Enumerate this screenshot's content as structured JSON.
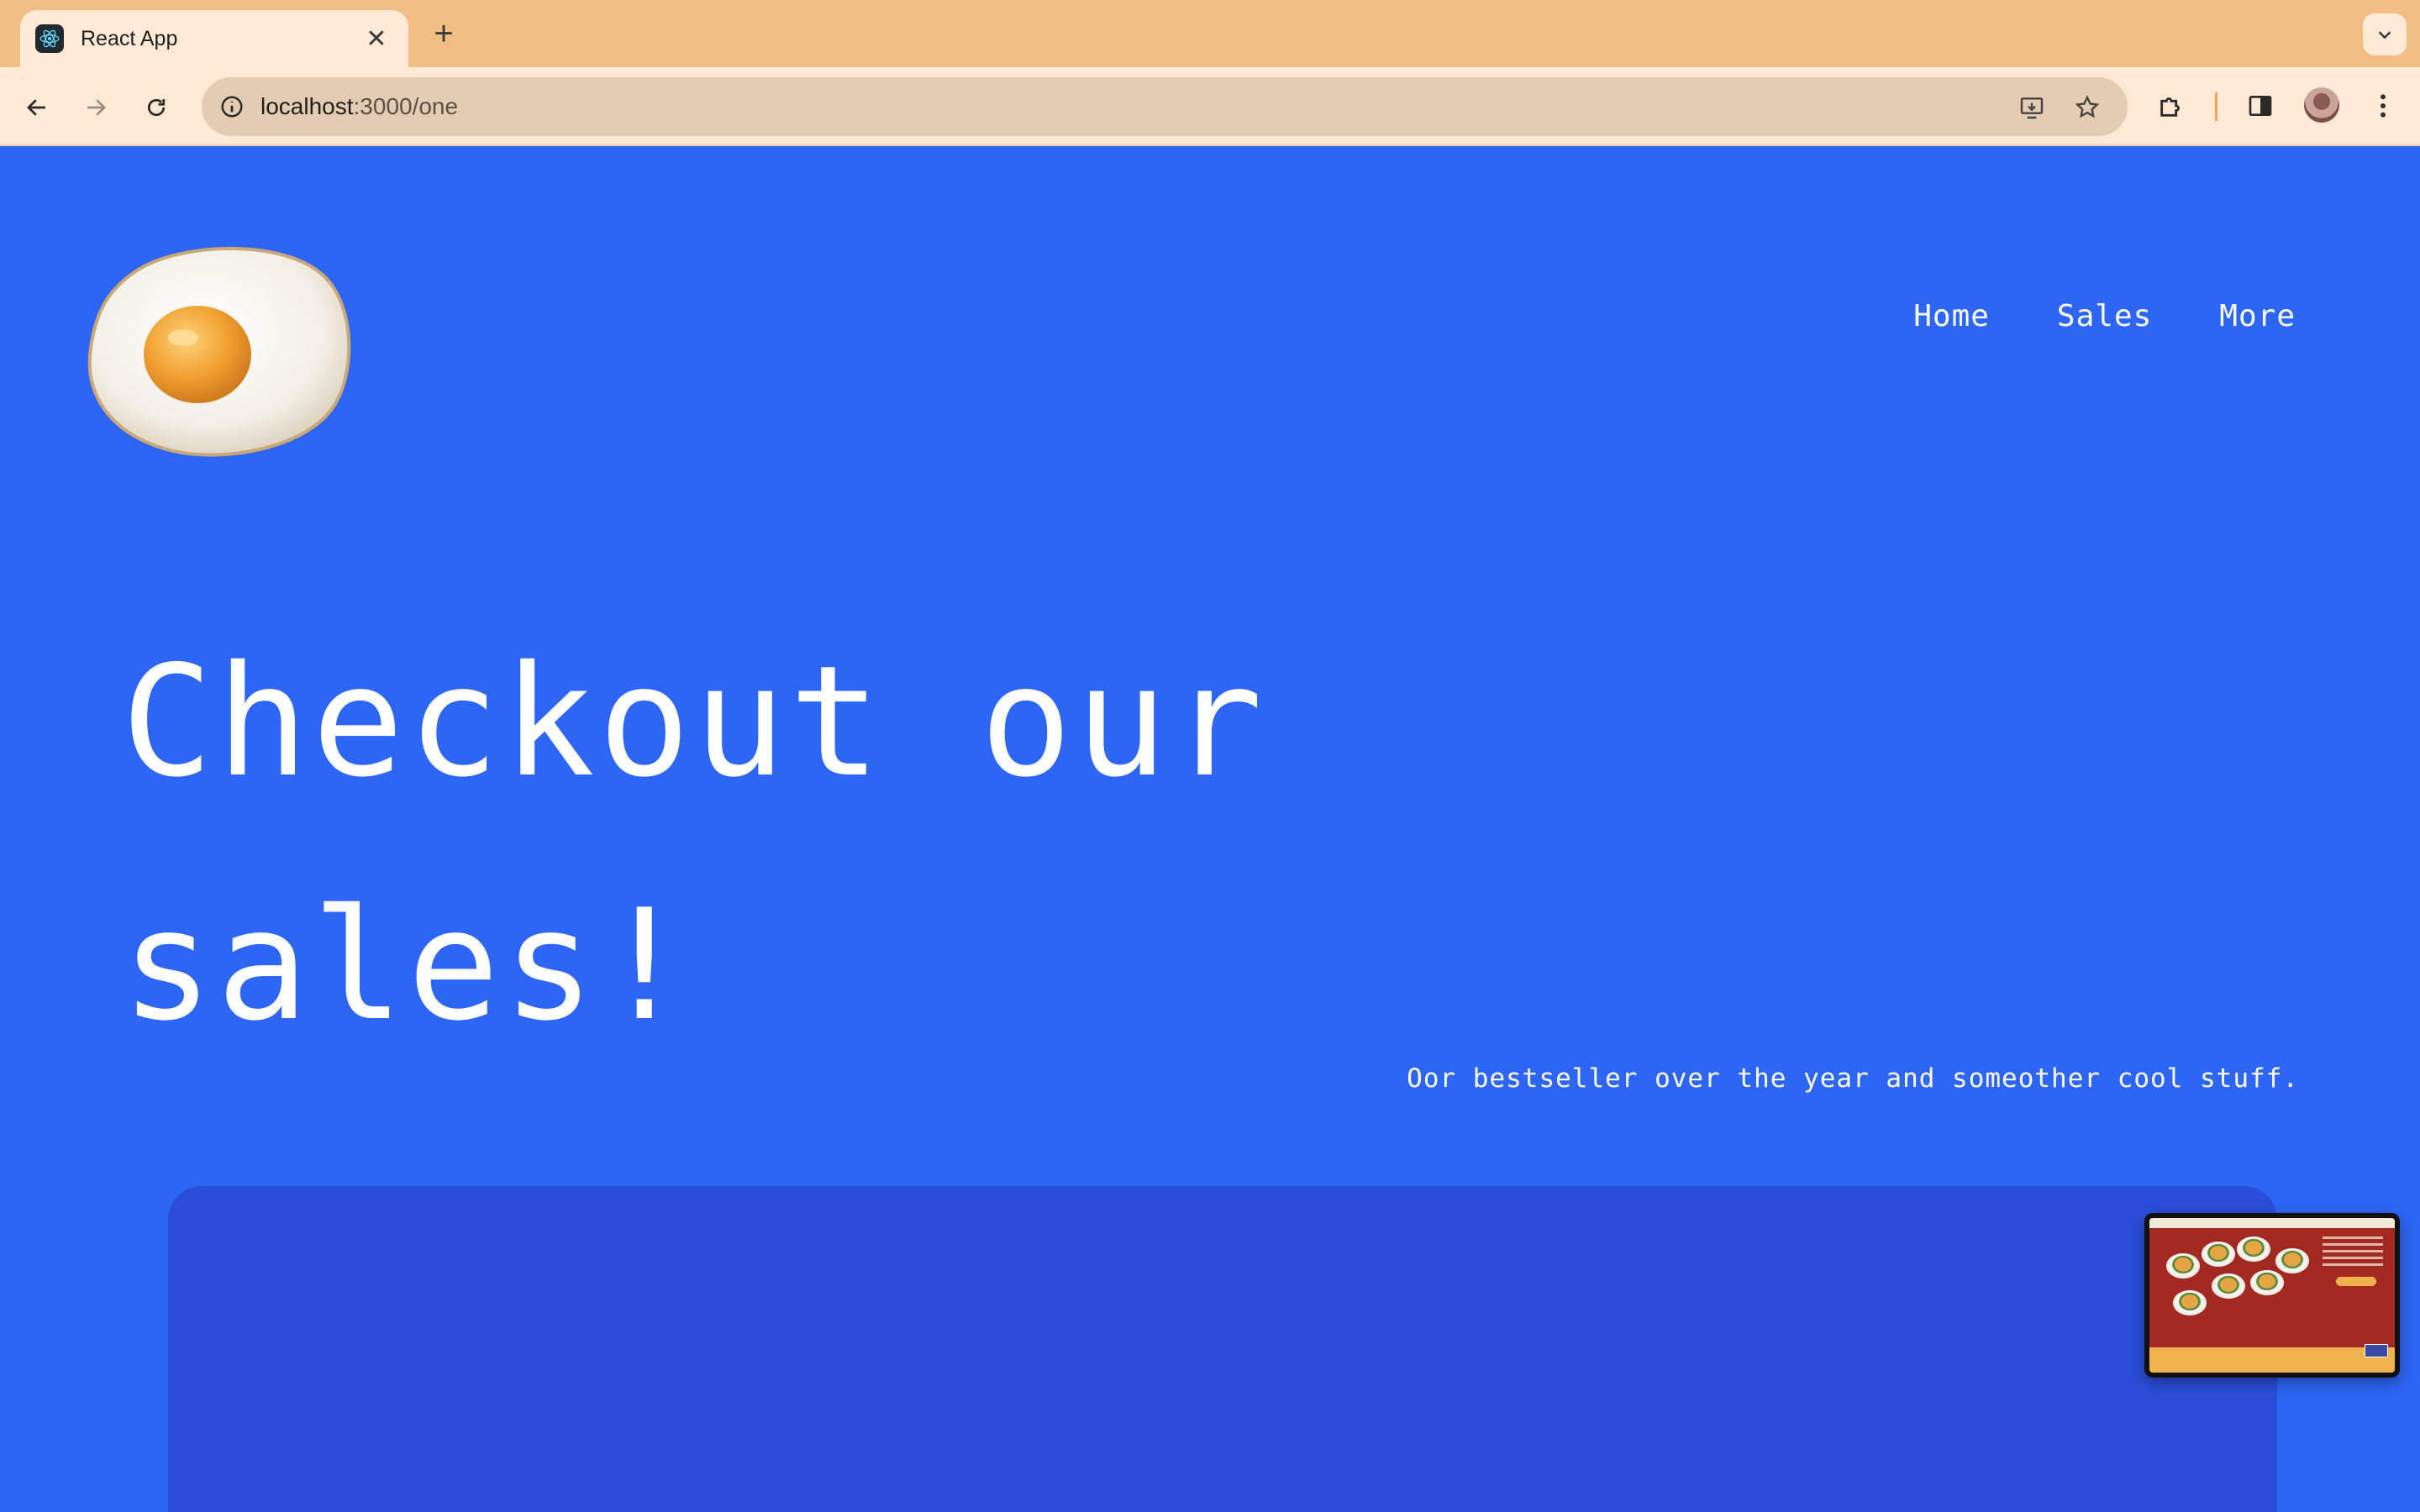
{
  "browser": {
    "tab_title": "React App",
    "url_host": "localhost",
    "url_path": ":3000/one",
    "icons": [
      "react-favicon",
      "close-icon",
      "plus-icon",
      "chevron-down-icon",
      "back-arrow-icon",
      "forward-arrow-icon",
      "reload-icon",
      "info-icon",
      "install-app-icon",
      "star-icon",
      "extensions-puzzle-icon",
      "side-panel-icon",
      "profile-avatar",
      "kebab-menu-icon"
    ]
  },
  "page": {
    "logo_alt": "fried egg",
    "nav": {
      "home": "Home",
      "sales": "Sales",
      "more": "More"
    },
    "headline": "Checkout our sales!",
    "subline": "Oor bestseller over the year and someother cool stuff."
  },
  "colors": {
    "page_bg": "#2d66f5",
    "card_bg": "#2a4ed9",
    "tabbar_bg": "#f0bd83",
    "toolbar_bg": "#fde9d4"
  }
}
